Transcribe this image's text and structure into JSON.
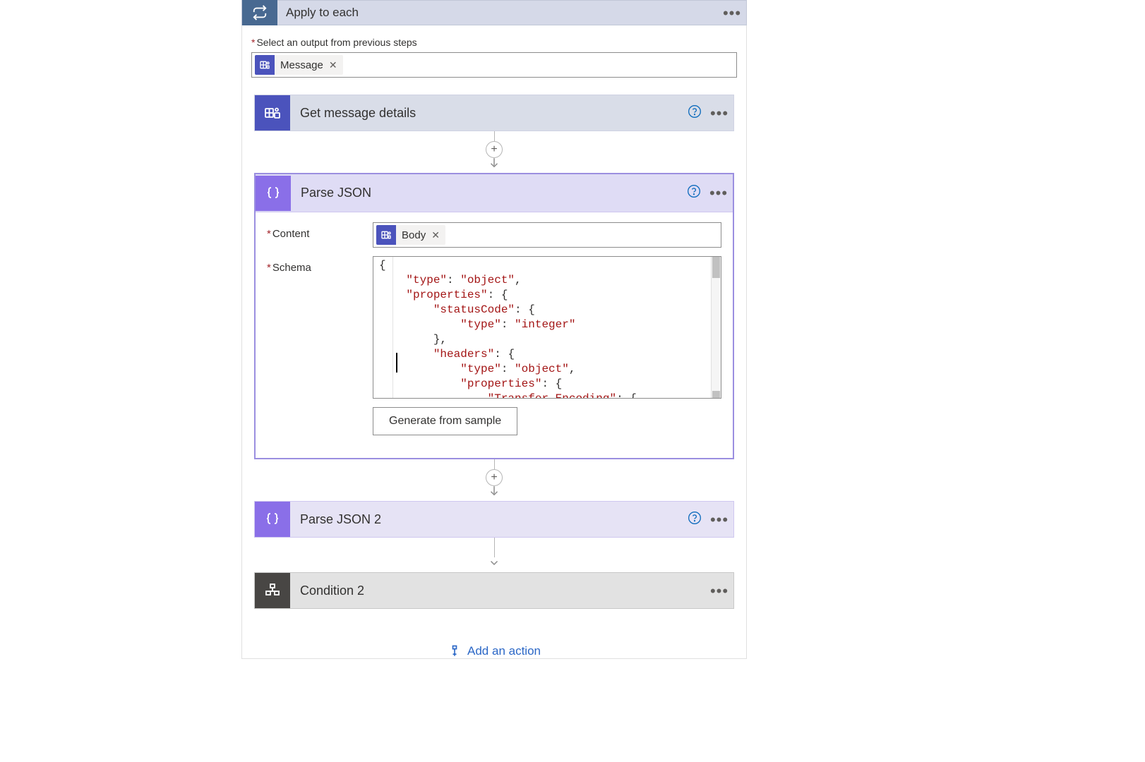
{
  "applyToEach": {
    "title": "Apply to each",
    "selectOutputLabel": "Select an output from previous steps",
    "token": {
      "label": "Message"
    }
  },
  "getMessageDetails": {
    "title": "Get message details"
  },
  "parseJson": {
    "title": "Parse JSON",
    "contentLabel": "Content",
    "contentToken": {
      "label": "Body"
    },
    "schemaLabel": "Schema",
    "schemaLine1a": "{",
    "schemaLine2k": "\"type\"",
    "schemaLine2v": "\"object\"",
    "schemaLine3k": "\"properties\"",
    "schemaLine4k": "\"statusCode\"",
    "schemaLine5k": "\"type\"",
    "schemaLine5v": "\"integer\"",
    "schemaLine7k": "\"headers\"",
    "schemaLine8k": "\"type\"",
    "schemaLine8v": "\"object\"",
    "schemaLine9k": "\"properties\"",
    "schemaLine10k": "\"Transfer-Encoding\"",
    "generateButton": "Generate from sample"
  },
  "parseJson2": {
    "title": "Parse JSON 2"
  },
  "condition2": {
    "title": "Condition 2"
  },
  "addAction": {
    "label": "Add an action"
  }
}
